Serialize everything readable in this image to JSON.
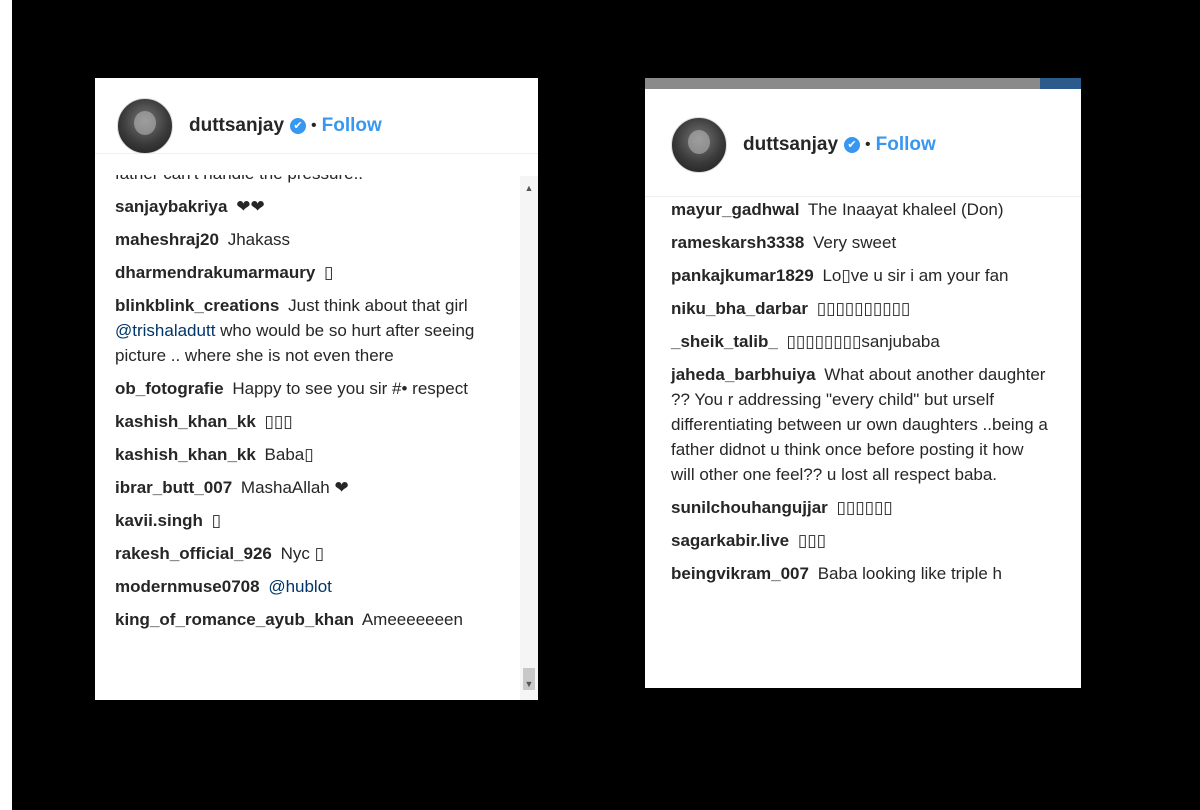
{
  "left_panel": {
    "header": {
      "username": "duttsanjay",
      "separator": "•",
      "follow_label": "Follow"
    },
    "comments": [
      {
        "user": "",
        "text": "father can't handle the pressure.."
      },
      {
        "user": "sanjaybakriya",
        "text": "❤❤"
      },
      {
        "user": "maheshraj20",
        "text": "Jhakass"
      },
      {
        "user": "dharmendrakumarmaury",
        "text": "▯"
      },
      {
        "user": "blinkblink_creations",
        "text": "Just think about that girl",
        "mention": "@trishaladutt",
        "text_after": "who would be so hurt after seeing picture .. where she is not even there"
      },
      {
        "user": "ob_fotografie",
        "text": "Happy to see you sir #• respect"
      },
      {
        "user": "kashish_khan_kk",
        "text": "▯▯▯"
      },
      {
        "user": "kashish_khan_kk",
        "text": "Baba▯"
      },
      {
        "user": "ibrar_butt_007",
        "text": "MashaAllah ❤"
      },
      {
        "user": "kavii.singh",
        "text": "▯"
      },
      {
        "user": "rakesh_official_926",
        "text": "Nyc ▯"
      },
      {
        "user": "modernmuse0708",
        "text": "",
        "mention": "@hublot"
      },
      {
        "user": "king_of_romance_ayub_khan",
        "text": "Ameeeeeeen"
      }
    ]
  },
  "right_panel": {
    "header": {
      "username": "duttsanjay",
      "separator": "•",
      "follow_label": "Follow"
    },
    "comments": [
      {
        "user": "mayur_gadhwal",
        "text": "The Inaayat khaleel (Don)"
      },
      {
        "user": "rameskarsh3338",
        "text": "Very sweet"
      },
      {
        "user": "pankajkumar1829",
        "text": "Lo▯ve u sir i am your fan"
      },
      {
        "user": "niku_bha_darbar",
        "text": "▯▯▯▯▯▯▯▯▯▯"
      },
      {
        "user": "_sheik_talib_",
        "text": "▯▯▯▯▯▯▯▯sanjubaba"
      },
      {
        "user": "jaheda_barbhuiya",
        "text": "What about another daughter ?? You r addressing \"every child\" but urself differentiating between ur own daughters ..being a father didnot u think once before posting it how will other one feel?? u lost all respect baba."
      },
      {
        "user": "sunilchouhangujjar",
        "text": "▯▯▯▯▯▯"
      },
      {
        "user": "sagarkabir.live",
        "text": "▯▯▯"
      },
      {
        "user": "beingvikram_007",
        "text": "Baba looking like triple h"
      }
    ]
  },
  "colors": {
    "link": "#3897f0",
    "mention": "#003569",
    "text": "#262626"
  }
}
